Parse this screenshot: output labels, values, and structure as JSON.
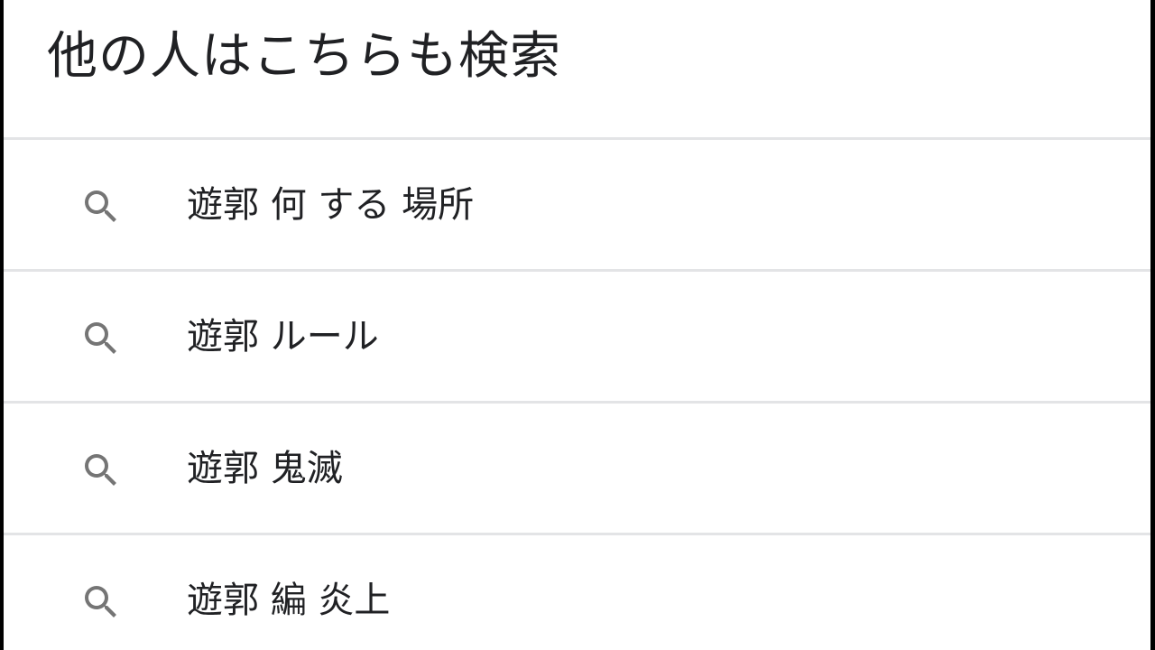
{
  "section": {
    "title": "他の人はこちらも検索"
  },
  "suggestions": [
    {
      "icon": "search-icon",
      "label": "遊郭 何 する 場所"
    },
    {
      "icon": "search-icon",
      "label": "遊郭 ルール"
    },
    {
      "icon": "search-icon",
      "label": "遊郭 鬼滅"
    },
    {
      "icon": "search-icon",
      "label": "遊郭 編 炎上"
    }
  ],
  "colors": {
    "text": "#202124",
    "icon": "#757575",
    "divider": "#e3e4e6",
    "background": "#ffffff"
  }
}
